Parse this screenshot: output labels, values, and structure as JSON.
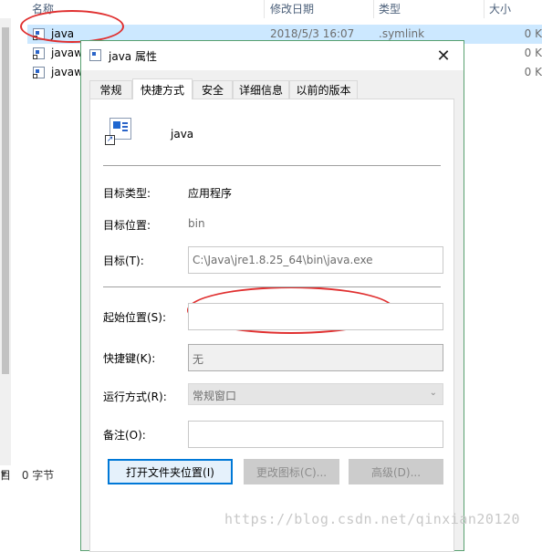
{
  "explorer": {
    "columns": {
      "name": "名称",
      "date": "修改日期",
      "type": "类型",
      "size": "大小"
    },
    "files": [
      {
        "name": "java",
        "date": "2018/5/3 16:07",
        "type": ".symlink",
        "size": "0 K"
      },
      {
        "name": "javaw",
        "date": "",
        "type": "",
        "size": "0 K"
      },
      {
        "name": "javaw",
        "date": "",
        "type": "",
        "size": "0 K"
      }
    ],
    "status_left": "目",
    "status_size": "0 字节"
  },
  "dialog": {
    "title": "java 属性",
    "close_glyph": "✕",
    "tabs": [
      "常规",
      "快捷方式",
      "安全",
      "详细信息",
      "以前的版本"
    ],
    "active_tab": 1,
    "shortcut_name": "java",
    "target_type_label": "目标类型:",
    "target_type_value": "应用程序",
    "target_location_label": "目标位置:",
    "target_location_value": "bin",
    "target_label": "目标(T):",
    "target_value": "C:\\Java\\jre1.8.25_64\\bin\\java.exe",
    "start_in_label": "起始位置(S):",
    "start_in_value": "",
    "hotkey_label": "快捷键(K):",
    "hotkey_value": "无",
    "run_label": "运行方式(R):",
    "run_value": "常规窗口",
    "comment_label": "备注(O):",
    "comment_value": "",
    "buttons": {
      "open_location": "打开文件夹位置(I)",
      "change_icon": "更改图标(C)...",
      "advanced": "高级(D)..."
    }
  },
  "watermark": "https://blog.csdn.net/qinxian20120",
  "colors": {
    "highlight": "#cce8ff",
    "annotation_red": "#e03030",
    "primary_border": "#0078d7"
  }
}
